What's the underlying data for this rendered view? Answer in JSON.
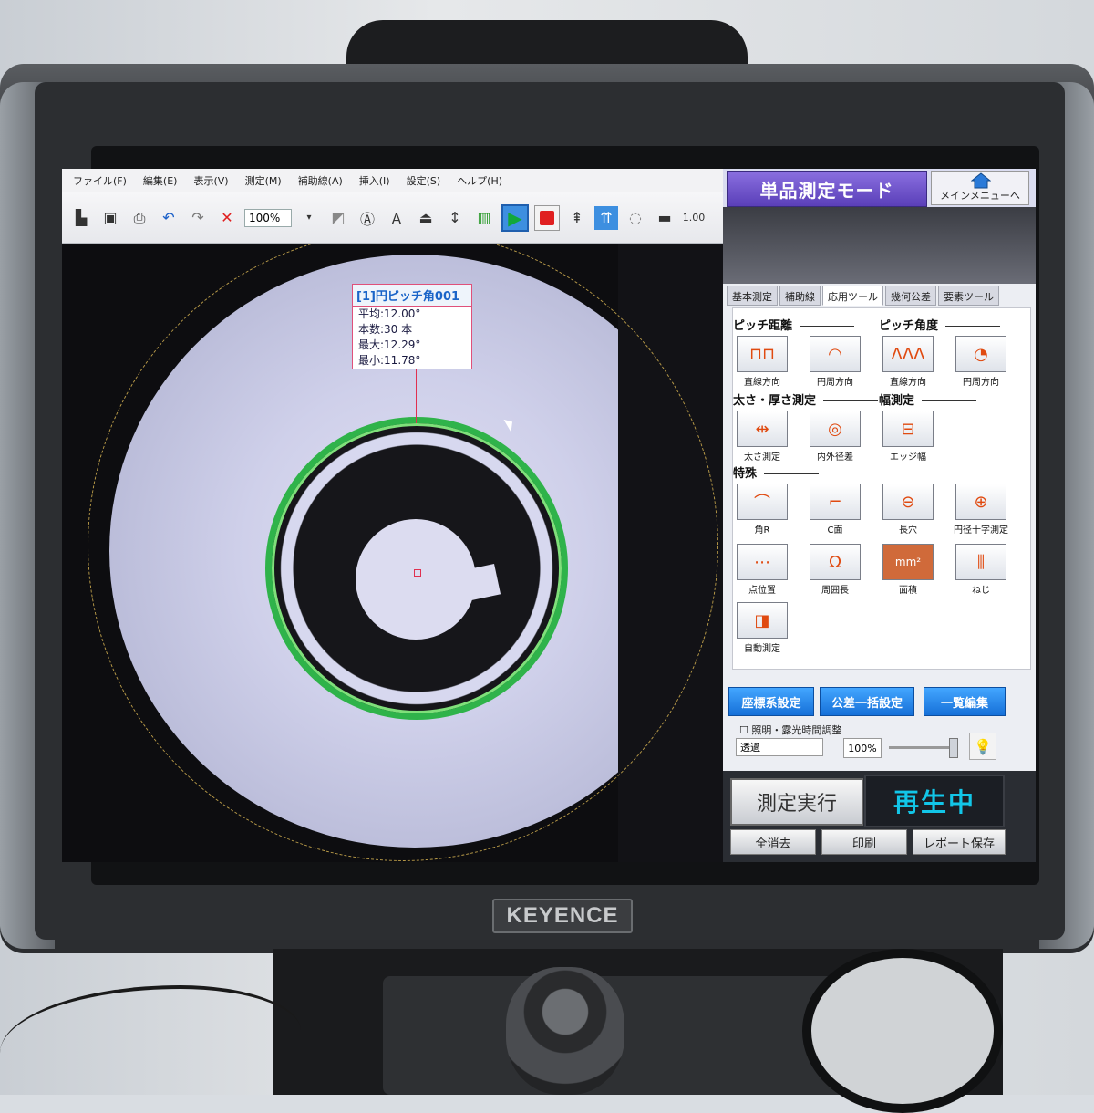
{
  "menu": [
    "ファイル(F)",
    "編集(E)",
    "表示(V)",
    "測定(M)",
    "補助線(A)",
    "挿入(I)",
    "設定(S)",
    "ヘルプ(H)"
  ],
  "toolbar": {
    "zoom_value": "100%"
  },
  "annotation": {
    "title": "[1]円ピッチ角001",
    "lines": [
      "平均:12.00°",
      "本数:30 本",
      "最大:12.29°",
      "最小:11.78°"
    ]
  },
  "panel": {
    "mode_title": "単品測定モード",
    "main_menu_label": "メインメニューへ",
    "tabs": [
      "基本測定",
      "補助線",
      "応用ツール",
      "幾何公差",
      "要素ツール"
    ],
    "active_tab": "応用ツール",
    "sections": {
      "pitch_distance": "ピッチ距離",
      "pitch_angle": "ピッチ角度",
      "thickness": "太さ・厚さ測定",
      "width": "幅測定",
      "special": "特殊"
    },
    "tools": {
      "linear_dir_1": "直線方向",
      "circ_dir_1": "円周方向",
      "linear_dir_2": "直線方向",
      "circ_dir_2": "円周方向",
      "thickness": "太さ測定",
      "inner_outer": "内外径差",
      "edge_width": "エッジ幅",
      "corner_r": "角R",
      "c_face": "C面",
      "long_hole": "長穴",
      "circle_cross": "円径十字測定",
      "point_pos": "点位置",
      "perimeter": "周囲長",
      "area": "面積",
      "screw": "ねじ",
      "auto_measure": "自動測定"
    },
    "buttons": {
      "coord_setting": "座標系設定",
      "tolerance_batch": "公差一括設定",
      "list_edit": "一覧編集"
    },
    "illumination": {
      "label": "照明・露光時間調整",
      "mode": "透過",
      "percent": "100%"
    },
    "run_button": "測定実行",
    "status": "再生中",
    "clear_all": "全消去",
    "print": "印刷",
    "report_save": "レポート保存"
  },
  "brand": "KEYENCE",
  "colors": {
    "accent": "#1670d8",
    "status": "#12c6e8",
    "mode": "#5a3fb8",
    "ring": "#2fb34a"
  }
}
